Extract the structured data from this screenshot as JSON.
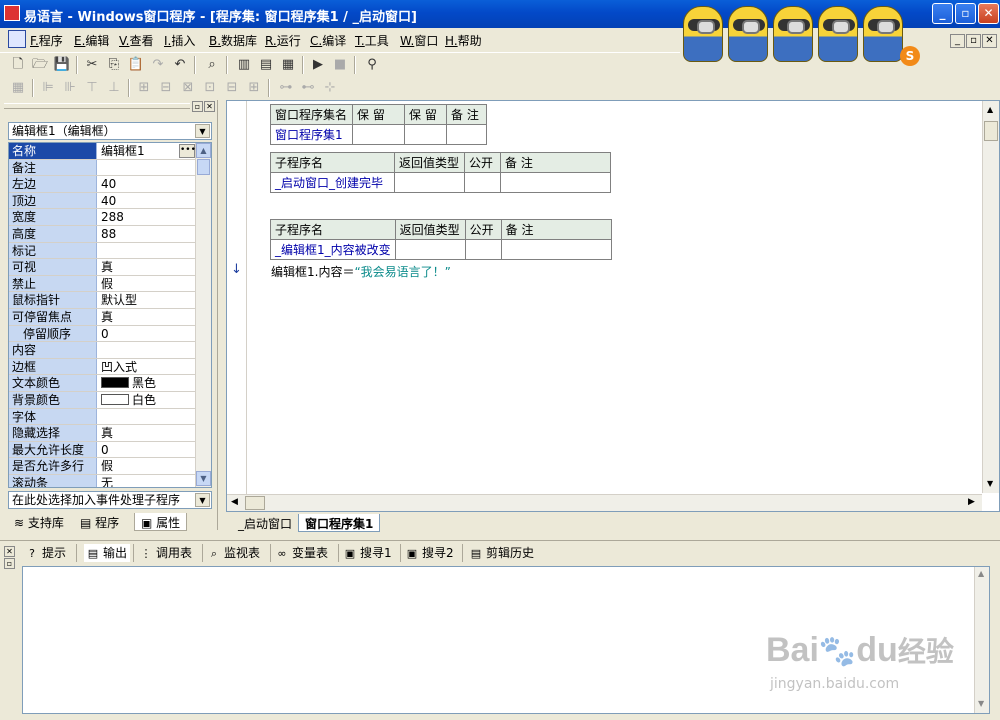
{
  "window": {
    "title": "易语言 - Windows窗口程序 - [程序集: 窗口程序集1 / _启动窗口]"
  },
  "menu": [
    {
      "key": "F.",
      "label": "程序"
    },
    {
      "key": "E.",
      "label": "编辑"
    },
    {
      "key": "V.",
      "label": "查看"
    },
    {
      "key": "I.",
      "label": "插入"
    },
    {
      "key": "B.",
      "label": "数据库"
    },
    {
      "key": "R.",
      "label": "运行"
    },
    {
      "key": "C.",
      "label": "编译"
    },
    {
      "key": "T.",
      "label": "工具"
    },
    {
      "key": "W.",
      "label": "窗口"
    },
    {
      "key": "H.",
      "label": "帮助"
    }
  ],
  "minion_badge": "S",
  "left_panel": {
    "object_selector": "编辑框1（编辑框）",
    "properties": [
      {
        "name": "名称",
        "value": "编辑框1"
      },
      {
        "name": "备注",
        "value": ""
      },
      {
        "name": "左边",
        "value": "40"
      },
      {
        "name": "顶边",
        "value": "40"
      },
      {
        "name": "宽度",
        "value": "288"
      },
      {
        "name": "高度",
        "value": "88"
      },
      {
        "name": "标记",
        "value": ""
      },
      {
        "name": "可视",
        "value": "真"
      },
      {
        "name": "禁止",
        "value": "假"
      },
      {
        "name": "鼠标指针",
        "value": "默认型"
      },
      {
        "name": "可停留焦点",
        "value": "真"
      },
      {
        "name": "停留顺序",
        "value": "0"
      },
      {
        "name": "内容",
        "value": ""
      },
      {
        "name": "边框",
        "value": "凹入式"
      },
      {
        "name": "文本颜色",
        "value": "黑色",
        "color": "#000000"
      },
      {
        "name": "背景颜色",
        "value": "白色",
        "color": "#ffffff"
      },
      {
        "name": "字体",
        "value": ""
      },
      {
        "name": "隐藏选择",
        "value": "真"
      },
      {
        "name": "最大允许长度",
        "value": "0"
      },
      {
        "name": "是否允许多行",
        "value": "假"
      },
      {
        "name": "滚动条",
        "value": "无"
      }
    ],
    "event_selector": "在此处选择加入事件处理子程序",
    "tabs": [
      "支持库",
      "程序",
      "属性"
    ]
  },
  "editor": {
    "assembly_table": {
      "headers": [
        "窗口程序集名",
        "保 留",
        "保 留",
        "备 注"
      ],
      "row": [
        "窗口程序集1",
        "",
        "",
        ""
      ]
    },
    "sub1": {
      "headers": [
        "子程序名",
        "返回值类型",
        "公开",
        "备 注"
      ],
      "row": [
        "_启动窗口_创建完毕",
        "",
        "",
        ""
      ]
    },
    "sub2": {
      "headers": [
        "子程序名",
        "返回值类型",
        "公开",
        "备 注"
      ],
      "row": [
        "_编辑框1_内容被改变",
        "",
        "",
        ""
      ]
    },
    "code_line": {
      "prefix": "编辑框1.内容＝",
      "string": "“我会易语言了！”"
    },
    "tabs": [
      "_启动窗口",
      "窗口程序集1"
    ]
  },
  "bottom_tabs": [
    {
      "icon": "?",
      "label": "提示"
    },
    {
      "icon": "▤",
      "label": "输出"
    },
    {
      "icon": "⋮",
      "label": "调用表"
    },
    {
      "icon": "⌕",
      "label": "监视表"
    },
    {
      "icon": "∞",
      "label": "变量表"
    },
    {
      "icon": "▣",
      "label": "搜寻1"
    },
    {
      "icon": "▣",
      "label": "搜寻2"
    },
    {
      "icon": "▤",
      "label": "剪辑历史"
    }
  ],
  "watermark": {
    "brand": "Bai",
    "brand2": "du",
    "cn": "经验",
    "url": "jingyan.baidu.com"
  }
}
